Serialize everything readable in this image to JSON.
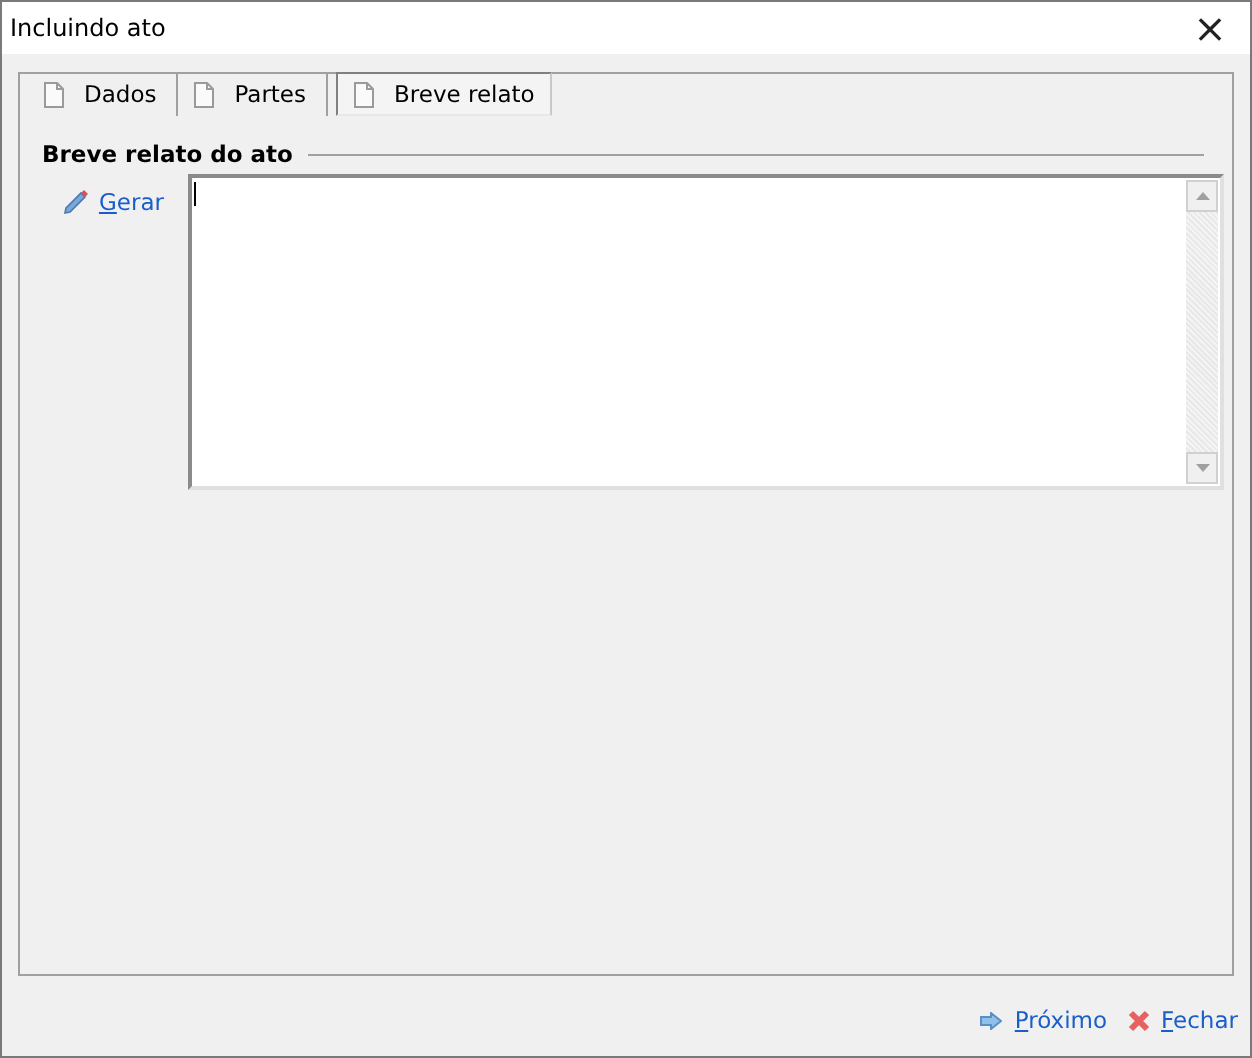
{
  "window": {
    "title": "Incluindo ato",
    "close": "×"
  },
  "tabs": [
    {
      "label": "Dados",
      "selected": false
    },
    {
      "label": "Partes",
      "selected": false
    },
    {
      "label": "Breve relato",
      "selected": true
    }
  ],
  "group": {
    "title": "Breve relato do ato",
    "action": "Gerar"
  },
  "footer": {
    "buttons": [
      {
        "kind": "next",
        "label": "Próximo"
      },
      {
        "kind": "close",
        "label": "Fechar"
      }
    ]
  }
}
